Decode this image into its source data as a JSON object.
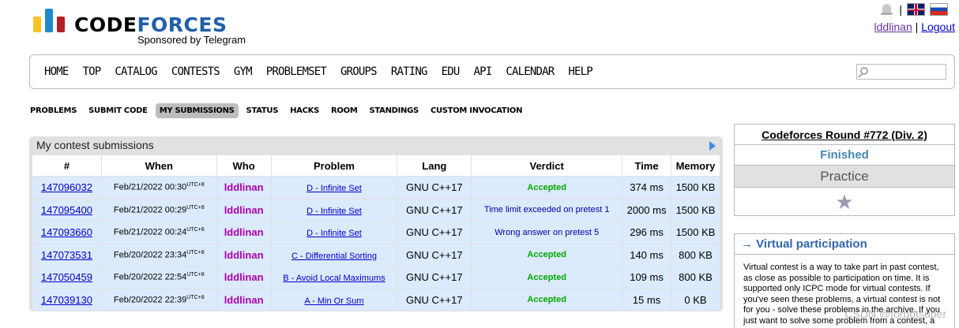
{
  "header": {
    "logo_word_1": "CODE",
    "logo_word_2": "FORCES",
    "sponsor": "Sponsored by Telegram",
    "separator": "|",
    "username": "lddlinan",
    "auth_separator": "|",
    "logout": "Logout"
  },
  "menu": {
    "items": [
      "HOME",
      "TOP",
      "CATALOG",
      "CONTESTS",
      "GYM",
      "PROBLEMSET",
      "GROUPS",
      "RATING",
      "EDU",
      "API",
      "CALENDAR",
      "HELP"
    ]
  },
  "submenu": {
    "items": [
      "PROBLEMS",
      "SUBMIT CODE",
      "MY SUBMISSIONS",
      "STATUS",
      "HACKS",
      "ROOM",
      "STANDINGS",
      "CUSTOM INVOCATION"
    ],
    "active": "MY SUBMISSIONS"
  },
  "submissions": {
    "caption": "My contest submissions",
    "columns": [
      "#",
      "When",
      "Who",
      "Problem",
      "Lang",
      "Verdict",
      "Time",
      "Memory"
    ],
    "utc": "UTC+8",
    "rows": [
      {
        "id": "147096032",
        "when": "Feb/21/2022 00:30",
        "who": "lddlinan",
        "problem": "D - Infinite Set",
        "lang": "GNU C++17",
        "verdict": "Accepted",
        "ok": true,
        "time": "374 ms",
        "memory": "1500 KB"
      },
      {
        "id": "147095400",
        "when": "Feb/21/2022 00:29",
        "who": "lddlinan",
        "problem": "D - Infinite Set",
        "lang": "GNU C++17",
        "verdict": "Time limit exceeded on pretest 1",
        "ok": false,
        "time": "2000 ms",
        "memory": "1500 KB"
      },
      {
        "id": "147093660",
        "when": "Feb/21/2022 00:24",
        "who": "lddlinan",
        "problem": "D - Infinite Set",
        "lang": "GNU C++17",
        "verdict": "Wrong answer on pretest 5",
        "ok": false,
        "time": "296 ms",
        "memory": "1500 KB"
      },
      {
        "id": "147073531",
        "when": "Feb/20/2022 23:34",
        "who": "lddlinan",
        "problem": "C - Differential Sorting",
        "lang": "GNU C++17",
        "verdict": "Accepted",
        "ok": true,
        "time": "140 ms",
        "memory": "800 KB"
      },
      {
        "id": "147050459",
        "when": "Feb/20/2022 22:54",
        "who": "lddlinan",
        "problem": "B - Avoid Local Maximums",
        "lang": "GNU C++17",
        "verdict": "Accepted",
        "ok": true,
        "time": "109 ms",
        "memory": "800 KB"
      },
      {
        "id": "147039130",
        "when": "Feb/20/2022 22:39",
        "who": "lddlinan",
        "problem": "A - Min Or Sum",
        "lang": "GNU C++17",
        "verdict": "Accepted",
        "ok": true,
        "time": "15 ms",
        "memory": "0 KB"
      }
    ]
  },
  "sidebar": {
    "round_title": "Codeforces Round #772 (Div. 2)",
    "status": "Finished",
    "practice": "Practice",
    "star_icon": "star-icon",
    "vp_title": "→ Virtual participation",
    "vp_text": "Virtual contest is a way to take part in past contest, as close as possible to participation on time. It is supported only ICPC mode for virtual contests. If you've seen these problems, a virtual contest is not for you - solve these problems in the archive. If you just want to solve some problem from a contest, a"
  },
  "watermark": "CSDN @forgotsuper",
  "colors": {
    "accepted": "#00aa00",
    "rejected": "#0000aa",
    "handle": "#aa00aa",
    "row_bg": "#dbeafc"
  }
}
